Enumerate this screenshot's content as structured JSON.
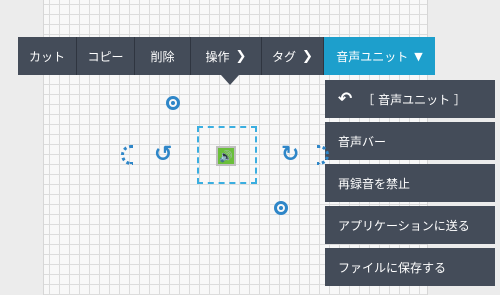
{
  "toolbar": {
    "cut": "カット",
    "copy": "コピー",
    "delete": "削除",
    "operation": "操作",
    "tag": "タグ",
    "audio_unit": "音声ユニット"
  },
  "menu": {
    "back_label": "［ 音声ユニット ］",
    "items": [
      "音声バー",
      "再録音を禁止",
      "アプリケーションに送る",
      "ファイルに保存する"
    ]
  },
  "icons": {
    "back": "back-arrow-icon",
    "chevron_right": "chevron-right-icon",
    "chevron_down": "chevron-down-icon",
    "anchor": "anchor-point-icon",
    "rotate": "rotate-icon",
    "audio": "audio-speaker-icon"
  },
  "colors": {
    "toolbar_bg": "#444c59",
    "active_bg": "#1d9fcc",
    "accent": "#2e86c8",
    "audio_green": "#6abf3a"
  }
}
